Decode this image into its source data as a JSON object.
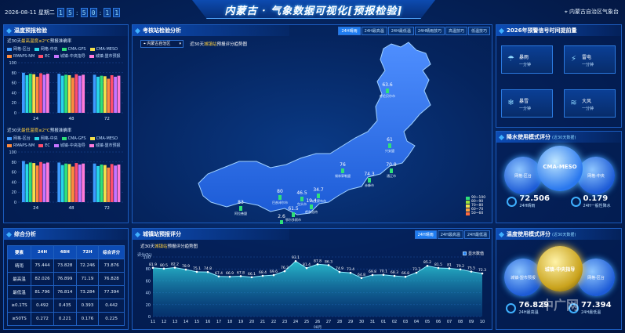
{
  "header": {
    "date": "2026-08-11 星期二",
    "time_digits": [
      "1",
      "5",
      "5",
      "0",
      "1",
      "1"
    ],
    "title": "内蒙古 · 气象数据可视化[预报检验]",
    "location": "内蒙古自治区气象台"
  },
  "left_top": {
    "title": "温度预报检验",
    "max_sub": {
      "prefix": "近30天",
      "hl": "最高温度≤2°C",
      "suffix": "预报准确率"
    },
    "min_sub": {
      "prefix": "近30天",
      "hl": "最低温度≤2°C",
      "suffix": "预报准确率"
    },
    "legend": [
      {
        "name": "网格-区台",
        "color": "#3d9bff"
      },
      {
        "name": "网格-中央",
        "color": "#27d7e8"
      },
      {
        "name": "CMA-GFS",
        "color": "#2fe07a"
      },
      {
        "name": "CMA-MESO",
        "color": "#f4e04a"
      },
      {
        "name": "RMAPS-NM",
        "color": "#ff8a3d"
      },
      {
        "name": "EC",
        "color": "#ff4d6d"
      },
      {
        "name": "城镇-中央指导",
        "color": "#c774ff"
      },
      {
        "name": "城镇-盟市预报",
        "color": "#ff7ad9"
      }
    ],
    "y_ticks": [
      "100",
      "80",
      "60",
      "40",
      "20",
      "0"
    ],
    "x_labels": [
      "24",
      "48",
      "72"
    ],
    "max_values": [
      [
        80,
        75,
        78,
        77,
        72,
        79,
        76,
        78
      ],
      [
        78,
        74,
        76,
        75,
        70,
        77,
        74,
        76
      ],
      [
        76,
        72,
        74,
        73,
        68,
        75,
        72,
        74
      ]
    ],
    "min_values": [
      [
        82,
        76,
        79,
        78,
        73,
        80,
        77,
        79
      ],
      [
        79,
        74,
        77,
        76,
        71,
        78,
        75,
        77
      ],
      [
        77,
        72,
        75,
        74,
        69,
        76,
        73,
        75
      ]
    ]
  },
  "summary": {
    "title": "综合分析",
    "columns": [
      "要素",
      "24H",
      "48H",
      "72H",
      "综合评分"
    ],
    "rows": [
      [
        "晴雨",
        "75.444",
        "73.828",
        "72.246",
        "73.876"
      ],
      [
        "最高温",
        "82.026",
        "76.899",
        "71.19",
        "76.828"
      ],
      [
        "最低温",
        "81.796",
        "76.814",
        "73.284",
        "77.394"
      ],
      [
        "≥0.1TS",
        "0.492",
        "0.435",
        "0.393",
        "0.442"
      ],
      [
        "≥50TS",
        "0.272",
        "0.221",
        "0.176",
        "0.225"
      ]
    ]
  },
  "center_top": {
    "title": "考核站检验分析",
    "tabs": [
      "24H晴雨",
      "24H最高温",
      "24H最低温",
      "24H晴雨技巧",
      "高温技巧",
      "低温技巧"
    ],
    "region_select": "内蒙古自治区",
    "map_sub": {
      "prefix": "近30天",
      "hl": "城镇站",
      "suffix": "预报评分趋势图"
    },
    "map_labels": [
      {
        "value": "63.6",
        "name": "呼伦贝尔市"
      },
      {
        "value": "61",
        "name": "兴安盟"
      },
      {
        "value": "70.9",
        "name": "通辽市"
      },
      {
        "value": "74.3",
        "name": "赤峰市"
      },
      {
        "value": "76",
        "name": "锡林郭勒盟"
      },
      {
        "value": "80",
        "name": "巴彦淖尔市"
      },
      {
        "value": "83",
        "name": "阿拉善盟"
      },
      {
        "value": "46.5",
        "name": "包头市"
      },
      {
        "value": "34.7",
        "name": "乌兰察布市"
      },
      {
        "value": "19.4",
        "name": "呼和浩特"
      },
      {
        "value": "61.5",
        "name": "鄂尔多斯市"
      },
      {
        "value": "2.6",
        "name": "乌海市"
      }
    ],
    "scale": [
      {
        "label": "90~100",
        "color": "#2fe07a"
      },
      {
        "label": "80~90",
        "color": "#9be23a"
      },
      {
        "label": "70~80",
        "color": "#f4e04a"
      },
      {
        "label": "60~70",
        "color": "#ffa13d"
      },
      {
        "label": "50~60",
        "color": "#ff6a3d"
      }
    ]
  },
  "center_bottom": {
    "title": "城镇站预报评分",
    "tabs": [
      "24H晴雨",
      "24H最高温",
      "24H最低温"
    ],
    "chart_sub": {
      "prefix": "近30天",
      "hl": "城镇站",
      "suffix": "预报评分趋势图"
    },
    "show_values_label": "显示数值"
  },
  "right_top": {
    "title": "2026年预警信号时间提前量",
    "cards": [
      {
        "name": "暴雨",
        "value": "一分钟",
        "icon": "☂"
      },
      {
        "name": "雷电",
        "value": "一分钟",
        "icon": "⚡"
      },
      {
        "name": "暴雪",
        "value": "一分钟",
        "icon": "❄"
      },
      {
        "name": "大风",
        "value": "一分钟",
        "icon": "≋"
      }
    ]
  },
  "right_mid": {
    "title": "降水使用模式评分",
    "title_note": "(近30天数据)",
    "center_model": "CMA-MESO",
    "left_model": "网格-区台",
    "right_model": "网格-中央",
    "stat1": {
      "value": "72.506",
      "label": "24H晴雨"
    },
    "stat2": {
      "value": "0.179",
      "label": "24H一般性降水"
    }
  },
  "right_bottom": {
    "title": "温度使用模式评分",
    "title_note": "(近30天数据)",
    "center_model": "城镇-中央指导",
    "left_model": "城镇-盟市预报",
    "right_model": "网格-区台",
    "stat1": {
      "value": "76.829",
      "label": "24H最高温"
    },
    "stat2": {
      "value": "77.394",
      "label": "24H最低温"
    }
  },
  "watermark": "中广网",
  "chart_data": {
    "type": "area",
    "title": "近30天城镇站预报评分趋势图",
    "ylabel": "评分(%)",
    "xlabel": "08月",
    "ylim": [
      0,
      100
    ],
    "y_ticks": [
      0,
      20,
      40,
      60,
      80,
      100
    ],
    "categories": [
      "11",
      "12",
      "13",
      "14",
      "15",
      "16",
      "17",
      "18",
      "19",
      "20",
      "21",
      "22",
      "23",
      "24",
      "25",
      "26",
      "27",
      "28",
      "29",
      "30",
      "31",
      "01",
      "02",
      "03",
      "04",
      "05",
      "06",
      "07",
      "08",
      "09",
      "10"
    ],
    "values": [
      81.9,
      80.5,
      82.2,
      78.9,
      75.1,
      74.8,
      67.4,
      66.9,
      67.8,
      66.1,
      68.4,
      69.6,
      76.2,
      93.1,
      81.4,
      87.8,
      86.3,
      74.9,
      73.4,
      64.8,
      69.8,
      70.1,
      68.3,
      66.8,
      73.7,
      85.2,
      81.5,
      81.0,
      79.2,
      75.5,
      72.3
    ]
  }
}
